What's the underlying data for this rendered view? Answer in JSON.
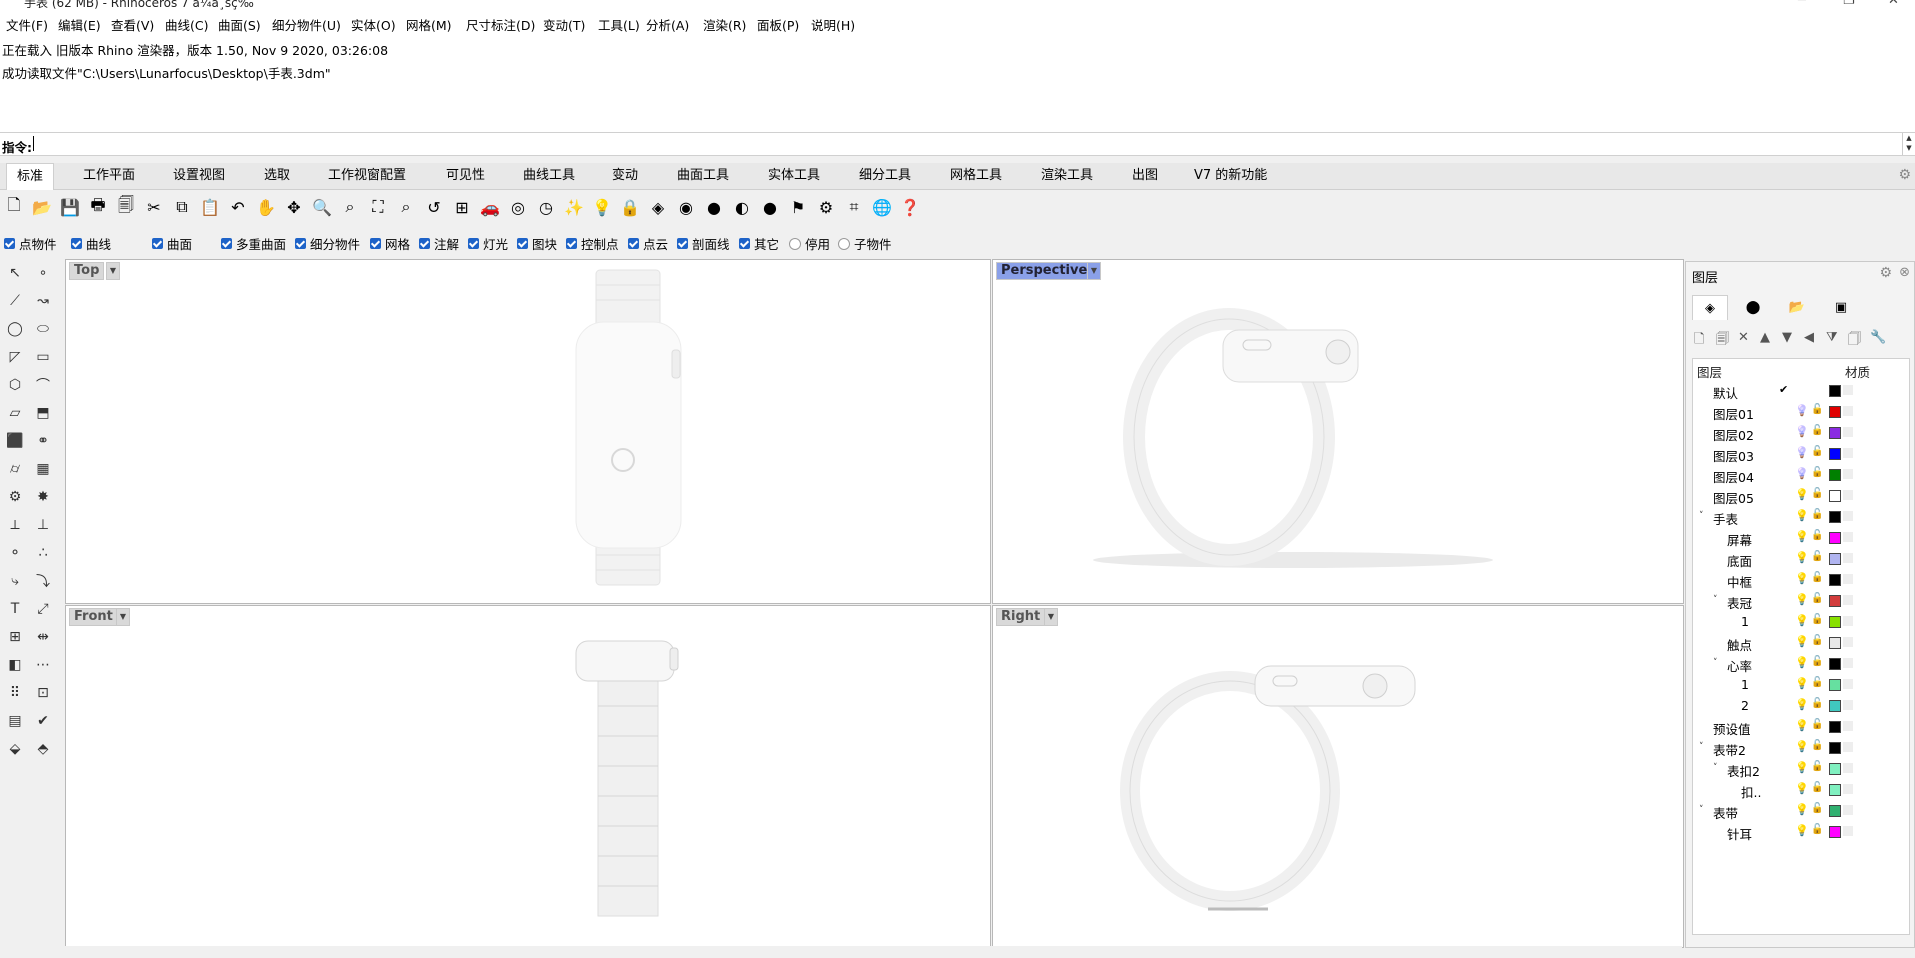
{
  "window": {
    "title": "手表 (62 MB) - Rhinoceros 7 à¼ä¸šç‰ˆ",
    "minimize_icon": "minimize-icon",
    "maximize_icon": "maximize-icon",
    "close_icon": "close-icon"
  },
  "menu": [
    "文件(F)",
    "编辑(E)",
    "查看(V)",
    "曲线(C)",
    "曲面(S)",
    "细分物件(U)",
    "实体(O)",
    "网格(M)",
    "尺寸标注(D)",
    "变动(T)",
    "工具(L)",
    "分析(A)",
    "渲染(R)",
    "面板(P)",
    "说明(H)"
  ],
  "history": [
    "正在载入 旧版本 Rhino 渲染器，版本 1.50, Nov  9 2020, 03:26:08",
    "成功读取文件\"C:\\Users\\Lunarfocus\\Desktop\\手表.3dm\""
  ],
  "command": {
    "label": "指令:",
    "value": ""
  },
  "tabs": [
    "标准",
    "工作平面",
    "设置视图",
    "选取",
    "工作视窗配置",
    "可见性",
    "曲线工具",
    "变动",
    "曲面工具",
    "实体工具",
    "细分工具",
    "网格工具",
    "渲染工具",
    "出图",
    "V7 的新功能"
  ],
  "active_tab": "标准",
  "toolbar_icons": [
    "new-icon",
    "open-icon",
    "save-icon",
    "print-icon",
    "import-icon",
    "cut-icon",
    "copy-icon",
    "paste-icon",
    "undo-icon",
    "pan-icon",
    "rotate-view-icon",
    "zoom-icon",
    "zoom-window-icon",
    "zoom-extents-icon",
    "zoom-selected-icon",
    "undo-view-icon",
    "four-viewports-icon",
    "car-icon",
    "render-icon",
    "clock-icon",
    "display-icon",
    "light-bulb-icon",
    "lock-icon",
    "layers-icon",
    "color-wheel-icon",
    "sphere-icon",
    "shaded-sphere-icon",
    "render-sphere-icon",
    "flag-icon",
    "gear-cluster-icon",
    "snap-icon",
    "globe-icon",
    "help-icon"
  ],
  "filters": [
    {
      "label": "点物件",
      "checked": true
    },
    {
      "label": "曲线",
      "checked": true
    },
    {
      "label": "曲面",
      "checked": true
    },
    {
      "label": "多重曲面",
      "checked": true
    },
    {
      "label": "细分物件",
      "checked": true
    },
    {
      "label": "网格",
      "checked": true
    },
    {
      "label": "注解",
      "checked": true
    },
    {
      "label": "灯光",
      "checked": true
    },
    {
      "label": "图块",
      "checked": true
    },
    {
      "label": "控制点",
      "checked": true
    },
    {
      "label": "点云",
      "checked": true
    },
    {
      "label": "剖面线",
      "checked": true
    },
    {
      "label": "其它",
      "checked": true
    },
    {
      "label": "停用",
      "checked": false
    },
    {
      "label": "子物件",
      "checked": false
    }
  ],
  "viewports": {
    "top": "Top",
    "perspective": "Perspective",
    "front": "Front",
    "right": "Right",
    "active": "Perspective"
  },
  "layers_panel": {
    "title": "图层",
    "col_layer": "图层",
    "col_material": "材质",
    "tabs": [
      "layers-tab-icon",
      "materials-tab-icon",
      "libraries-tab-icon",
      "display-tab-icon"
    ],
    "tools": [
      "new-layer-icon",
      "new-sublayer-icon",
      "delete-icon",
      "move-up-icon",
      "move-down-icon",
      "move-to-parent-icon",
      "filter-icon",
      "copy-layer-icon",
      "tools-icon"
    ],
    "rows": [
      {
        "name": "默认",
        "depth": 0,
        "current": true,
        "color": "#000000",
        "expand": ""
      },
      {
        "name": "图层01",
        "depth": 0,
        "color": "#e00000",
        "expand": "",
        "bulb": "#2e6fd6"
      },
      {
        "name": "图层02",
        "depth": 0,
        "color": "#8a2be2",
        "expand": "",
        "bulb": "#2e6fd6"
      },
      {
        "name": "图层03",
        "depth": 0,
        "color": "#0000ff",
        "expand": "",
        "bulb": "#2e6fd6"
      },
      {
        "name": "图层04",
        "depth": 0,
        "color": "#008000",
        "expand": "",
        "bulb": "#2e6fd6"
      },
      {
        "name": "图层05",
        "depth": 0,
        "color": "#ffffff",
        "expand": "",
        "bulb": "#e0b800"
      },
      {
        "name": "手表",
        "depth": 0,
        "color": "#000000",
        "expand": "˅",
        "bulb": "#e0b800"
      },
      {
        "name": "屏幕",
        "depth": 1,
        "color": "#ff00ff",
        "expand": "",
        "bulb": "#e0b800"
      },
      {
        "name": "底面",
        "depth": 1,
        "color": "#b0b4f0",
        "expand": "",
        "bulb": "#e0b800"
      },
      {
        "name": "中框",
        "depth": 1,
        "color": "#000000",
        "expand": "",
        "bulb": "#e0b800"
      },
      {
        "name": "表冠",
        "depth": 1,
        "color": "#d23c3c",
        "expand": "˅",
        "bulb": "#e0b800"
      },
      {
        "name": "1",
        "depth": 2,
        "color": "#88e000",
        "expand": "",
        "bulb": "#e0b800"
      },
      {
        "name": "触点",
        "depth": 1,
        "color": "#e8e8e8",
        "expand": "",
        "bulb": "#e0b800"
      },
      {
        "name": "心率",
        "depth": 1,
        "color": "#000000",
        "expand": "˅",
        "bulb": "#e0b800"
      },
      {
        "name": "1",
        "depth": 2,
        "color": "#66e0a0",
        "expand": "",
        "bulb": "#e0b800"
      },
      {
        "name": "2",
        "depth": 2,
        "color": "#40c8c0",
        "expand": "",
        "bulb": "#e0b800"
      },
      {
        "name": "预设值",
        "depth": 0,
        "color": "#000000",
        "expand": "",
        "bulb": "#e0b800"
      },
      {
        "name": "表带2",
        "depth": 0,
        "color": "#000000",
        "expand": "˅",
        "bulb": "#e0b800"
      },
      {
        "name": "表扣2",
        "depth": 1,
        "color": "#80f0c0",
        "expand": "˅",
        "bulb": "#e0b800"
      },
      {
        "name": "扣..",
        "depth": 2,
        "color": "#80f0c0",
        "expand": "",
        "bulb": "#e0b800"
      },
      {
        "name": "表带",
        "depth": 0,
        "color": "#30b070",
        "expand": "˅",
        "bulb": "#e0b800"
      },
      {
        "name": "针耳",
        "depth": 1,
        "color": "#ff00ff",
        "expand": "",
        "bulb": "#e0b800"
      }
    ]
  },
  "colors": {
    "active_viewport": "#8aa0e8",
    "checkbox": "#1e63c8"
  }
}
